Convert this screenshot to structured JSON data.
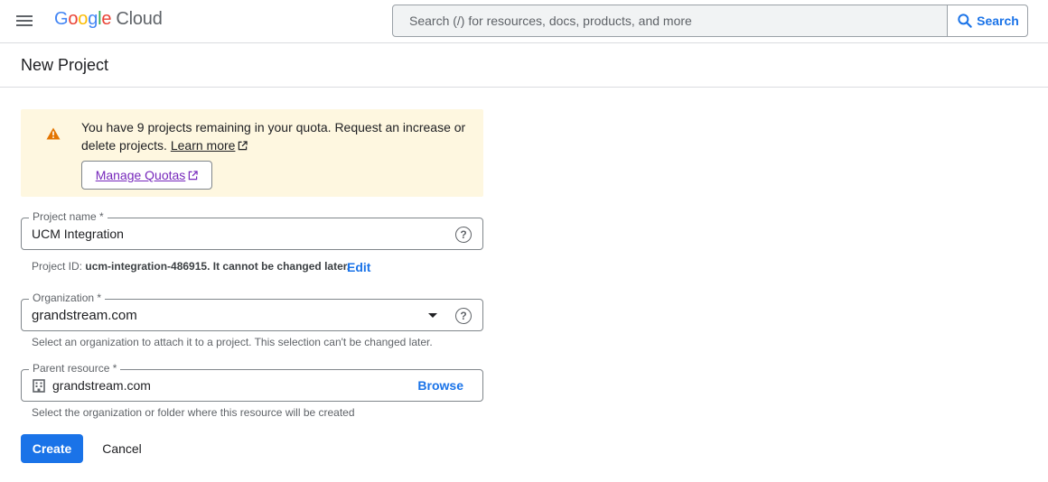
{
  "header": {
    "logo": {
      "google_letters": [
        {
          "char": "G",
          "color": "#4285f4"
        },
        {
          "char": "o",
          "color": "#ea4335"
        },
        {
          "char": "o",
          "color": "#fbbc04"
        },
        {
          "char": "g",
          "color": "#4285f4"
        },
        {
          "char": "l",
          "color": "#34a853"
        },
        {
          "char": "e",
          "color": "#ea4335"
        }
      ],
      "suffix": "Cloud"
    },
    "search": {
      "placeholder": "Search (/) for resources, docs, products, and more",
      "button_label": "Search"
    },
    "icons": {
      "menu": "hamburger-menu-icon",
      "search": "search-icon"
    }
  },
  "page": {
    "title": "New Project"
  },
  "quota_banner": {
    "message": "You have 9 projects remaining in your quota. Request an increase or delete projects.",
    "learn_more": "Learn more",
    "manage_quotas": "Manage Quotas",
    "icon": "warning-icon",
    "colors": {
      "background": "#fef7e0",
      "icon": "#e37400",
      "link": "#7627bb"
    }
  },
  "form": {
    "project_name": {
      "label": "Project name *",
      "value": "UCM Integration",
      "project_id_prefix": "Project ID:",
      "project_id": "ucm-integration-486915.",
      "project_id_suffix": "It cannot be changed later.",
      "edit_label": "Edit"
    },
    "organization": {
      "label": "Organization *",
      "value": "grandstream.com",
      "hint": "Select an organization to attach it to a project. This selection can't be changed later."
    },
    "parent_resource": {
      "label": "Parent resource *",
      "value": "grandstream.com",
      "browse_label": "Browse",
      "hint": "Select the organization or folder where this resource will be created"
    }
  },
  "actions": {
    "create": "Create",
    "cancel": "Cancel",
    "primary_color": "#1a73e8"
  }
}
